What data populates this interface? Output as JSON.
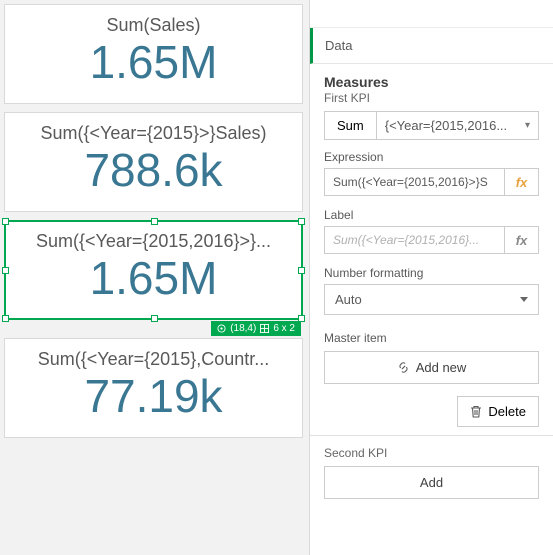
{
  "cards": [
    {
      "label": "Sum(Sales)",
      "value": "1.65M"
    },
    {
      "label": "Sum({<Year={2015}>}Sales)",
      "value": "788.6k"
    },
    {
      "label": "Sum({<Year={2015,2016}>}...",
      "value": "1.65M"
    },
    {
      "label": "Sum({<Year={2015},Countr...",
      "value": "77.19k"
    }
  ],
  "selection_badge": {
    "pos": "(18,4)",
    "size": "6 x 2"
  },
  "panel": {
    "section": "Data",
    "measures_title": "Measures",
    "first_kpi_label": "First KPI",
    "agg": "Sum",
    "field_display": "{<Year={2015,2016...",
    "expression_label": "Expression",
    "expression_value": "Sum({<Year={2015,2016}>}S",
    "label_label": "Label",
    "label_placeholder": "Sum({<Year={2015,2016}...",
    "number_formatting_label": "Number formatting",
    "number_formatting_value": "Auto",
    "master_item_label": "Master item",
    "add_new": "Add new",
    "delete": "Delete",
    "second_kpi_label": "Second KPI",
    "add": "Add"
  }
}
